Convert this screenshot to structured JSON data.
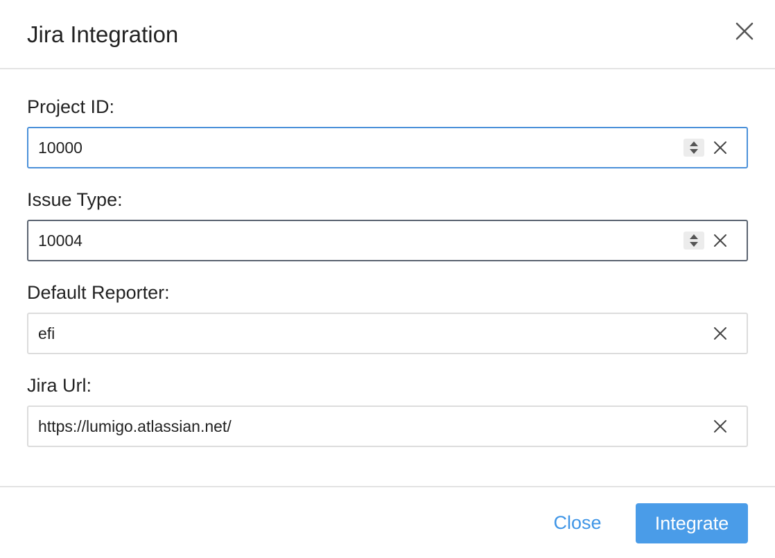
{
  "dialog": {
    "title": "Jira Integration"
  },
  "fields": {
    "project_id": {
      "label": "Project ID:",
      "value": "10000"
    },
    "issue_type": {
      "label": "Issue Type:",
      "value": "10004"
    },
    "default_reporter": {
      "label": "Default Reporter:",
      "value": "efi"
    },
    "jira_url": {
      "label": "Jira Url:",
      "value": "https://lumigo.atlassian.net/"
    }
  },
  "footer": {
    "close_label": "Close",
    "integrate_label": "Integrate"
  },
  "icons": {
    "close": "close-icon",
    "clear": "clear-icon",
    "spinner": "spinner-icon"
  },
  "colors": {
    "accent": "#4a9ce8",
    "focus_border": "#4a90d9",
    "link": "#3f95e6"
  }
}
